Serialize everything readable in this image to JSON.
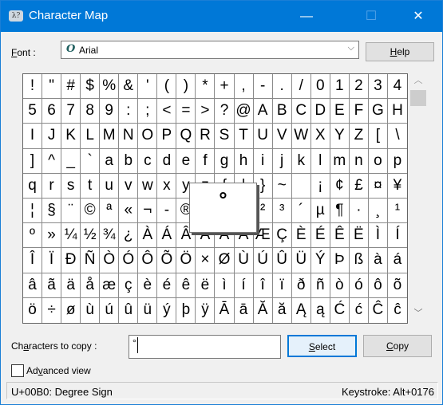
{
  "window": {
    "title": "Character Map",
    "minimize": "—",
    "maximize": "☐",
    "close": "✕",
    "icon": "charmap-app-icon"
  },
  "font": {
    "label_pre": "",
    "label_u": "F",
    "label_rest": "ont :",
    "value": "Arial",
    "font_icon": "O",
    "dropdown": "⌵"
  },
  "help_button": {
    "u": "H",
    "rest": "elp"
  },
  "grid": {
    "rows": [
      [
        "!",
        "\"",
        "#",
        "$",
        "%",
        "&",
        "'",
        "(",
        ")",
        "*",
        "+",
        ",",
        "-",
        ".",
        "/",
        "0",
        "1",
        "2",
        "3",
        "4"
      ],
      [
        "5",
        "6",
        "7",
        "8",
        "9",
        ":",
        ";",
        "<",
        "=",
        ">",
        "?",
        "@",
        "A",
        "B",
        "C",
        "D",
        "E",
        "F",
        "G",
        "H"
      ],
      [
        "I",
        "J",
        "K",
        "L",
        "M",
        "N",
        "O",
        "P",
        "Q",
        "R",
        "S",
        "T",
        "U",
        "V",
        "W",
        "X",
        "Y",
        "Z",
        "[",
        "\\"
      ],
      [
        "]",
        "^",
        "_",
        "`",
        "a",
        "b",
        "c",
        "d",
        "e",
        "f",
        "g",
        "h",
        "i",
        "j",
        "k",
        "l",
        "m",
        "n",
        "o",
        "p"
      ],
      [
        "q",
        "r",
        "s",
        "t",
        "u",
        "v",
        "w",
        "x",
        "y",
        "z",
        "{",
        "|",
        "}",
        "~",
        " ",
        "¡",
        "¢",
        "£",
        "¤",
        "¥"
      ],
      [
        "¦",
        "§",
        "¨",
        "©",
        "ª",
        "«",
        "¬",
        "-",
        "®",
        "¯",
        "°",
        "±",
        "²",
        "³",
        "´",
        "µ",
        "¶",
        "·",
        "¸",
        "¹"
      ],
      [
        "º",
        "»",
        "¼",
        "½",
        "¾",
        "¿",
        "À",
        "Á",
        "Â",
        "Ã",
        "Ä",
        "Å",
        "Æ",
        "Ç",
        "È",
        "É",
        "Ê",
        "Ë",
        "Ì",
        "Í"
      ],
      [
        "Î",
        "Ï",
        "Ð",
        "Ñ",
        "Ò",
        "Ó",
        "Ô",
        "Õ",
        "Ö",
        "×",
        "Ø",
        "Ù",
        "Ú",
        "Û",
        "Ü",
        "Ý",
        "Þ",
        "ß",
        "à",
        "á"
      ],
      [
        "â",
        "ã",
        "ä",
        "å",
        "æ",
        "ç",
        "è",
        "é",
        "ê",
        "ë",
        "ì",
        "í",
        "î",
        "ï",
        "ð",
        "ñ",
        "ò",
        "ó",
        "ô",
        "õ"
      ],
      [
        "ö",
        "÷",
        "ø",
        "ù",
        "ú",
        "û",
        "ü",
        "ý",
        "þ",
        "ÿ",
        "Ā",
        "ā",
        "Ă",
        "ă",
        "Ą",
        "ą",
        "Ć",
        "ć",
        "Ĉ",
        "ĉ"
      ]
    ],
    "selected": "°",
    "scroll_up": "︿",
    "scroll_down": "﹀"
  },
  "copy_row": {
    "label_pre": "Ch",
    "label_u": "a",
    "label_rest": "racters to copy :",
    "value": "°",
    "select_u": "S",
    "select_rest": "elect",
    "copy_u": "C",
    "copy_rest": "opy"
  },
  "advanced": {
    "label_pre": "Ad",
    "label_u": "v",
    "label_rest": "anced view",
    "checked": false
  },
  "status": {
    "left": "U+00B0: Degree Sign",
    "right": "Keystroke: Alt+0176"
  },
  "colors": {
    "titlebar": "#0078d7",
    "focus": "#0078d7"
  }
}
